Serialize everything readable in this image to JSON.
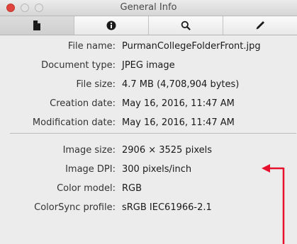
{
  "window": {
    "title": "General Info"
  },
  "toolbar": {
    "tabs": [
      {
        "name": "general",
        "icon": "file-icon",
        "active": true
      },
      {
        "name": "more-info",
        "icon": "info-icon",
        "active": false
      },
      {
        "name": "search",
        "icon": "magnifier-icon",
        "active": false
      },
      {
        "name": "edit",
        "icon": "pencil-icon",
        "active": false
      }
    ]
  },
  "info": {
    "file_name_label": "File name:",
    "file_name_value": "PurmanCollegeFolderFront.jpg",
    "document_type_label": "Document type:",
    "document_type_value": "JPEG image",
    "file_size_label": "File size:",
    "file_size_value": "4.7 MB (4,708,904 bytes)",
    "creation_date_label": "Creation date:",
    "creation_date_value": "May 16, 2016, 11:47 AM",
    "modification_date_label": "Modification date:",
    "modification_date_value": "May 16, 2016, 11:47 AM",
    "image_size_label": "Image size:",
    "image_size_value": "2906 × 3525 pixels",
    "image_dpi_label": "Image DPI:",
    "image_dpi_value": "300 pixels/inch",
    "color_model_label": "Color model:",
    "color_model_value": "RGB",
    "colorsync_label": "ColorSync profile:",
    "colorsync_value": "sRGB IEC61966-2.1"
  },
  "annotation": {
    "arrow_color": "#e8112d"
  }
}
